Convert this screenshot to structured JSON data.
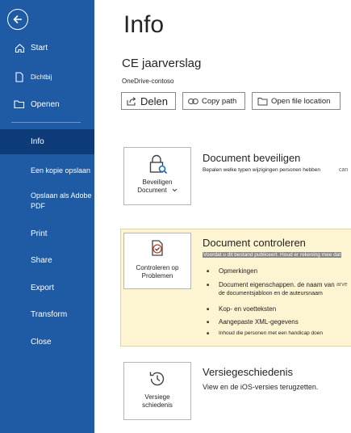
{
  "sidebar": {
    "items": [
      {
        "label": "Start",
        "icon": "home-icon"
      },
      {
        "label": "Dichtbij",
        "icon": "document-icon"
      },
      {
        "label": "Openen",
        "icon": "folder-icon"
      },
      {
        "label": "Info"
      },
      {
        "label": "Een kopie opslaan"
      },
      {
        "label": "Opslaan als Adobe",
        "label2": "PDF"
      },
      {
        "label": "Print"
      },
      {
        "label": "Share"
      },
      {
        "label": "Export"
      },
      {
        "label": "Transform"
      },
      {
        "label": "Close"
      }
    ]
  },
  "main": {
    "title": "Info",
    "doc_title": "CE jaarverslag",
    "doc_location": "OneDrive-contoso",
    "buttons": {
      "share": "Delen",
      "copy_path": "Copy path",
      "open_location": "Open file location"
    },
    "protect": {
      "card_line1": "Beveiligen",
      "card_line2": "Document",
      "title": "Document beveiligen",
      "desc": "Bepalen welke typen wijzigingen personen hebben",
      "trunc": "can"
    },
    "inspect": {
      "card_line1": "Controleren op",
      "card_line2": "Problemen",
      "title": "Document controleren",
      "desc": "Voordat u dit bestand publiceert. Houd er rekening mee dat",
      "items": [
        {
          "line1": "Opmerkingen"
        },
        {
          "line1": "Document eigenschappen. de naam van",
          "line2": "de documentsjabloon en de auteursnaam"
        },
        {
          "line1": "Kop- en voetteksten"
        },
        {
          "line1": "Aangepaste XML-gegevens"
        },
        {
          "line1": "Inhoud die personen met een handicap doen"
        }
      ],
      "trunc": "arve"
    },
    "history": {
      "card_line1": "Versiege",
      "card_line2": "schiedenis",
      "title": "Versiegeschiedenis",
      "desc": "View en de iOS-versies terugzetten."
    }
  },
  "colors": {
    "sidebar": "#1f5aa5",
    "sidebar_active": "#0e3c78",
    "panel_highlight": "#fdf4d2"
  }
}
